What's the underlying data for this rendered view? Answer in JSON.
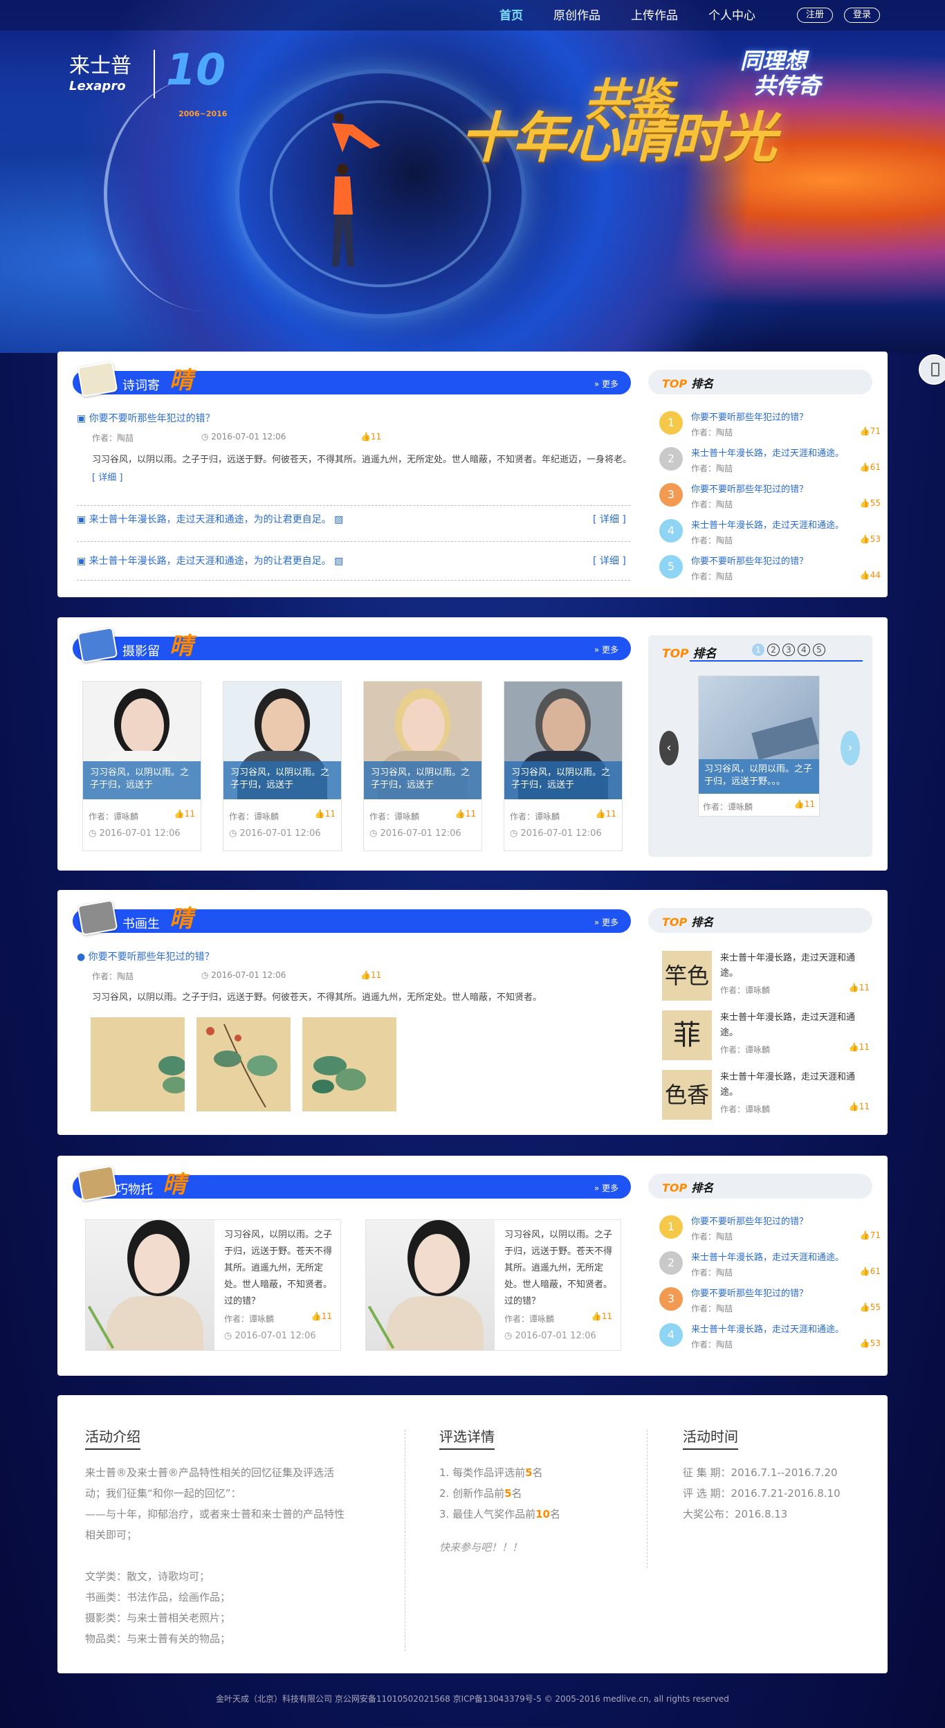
{
  "nav": {
    "items": [
      "首页",
      "原创作品",
      "上传作品",
      "个人中心"
    ],
    "register": "注册",
    "login": "登录"
  },
  "hero": {
    "brand_cn": "来士普",
    "brand_en": "Lexapro",
    "ten": "10",
    "years": "2006~2016",
    "slogan_right_1": "同理想",
    "slogan_right_2": "共传奇",
    "slogan_top": "共鉴",
    "slogan_main": "十年心晴时光"
  },
  "poem": {
    "title": "诗词寄",
    "hz": "晴",
    "more": "更多",
    "post_title": "你要不要听那些年犯过的错？",
    "post_author": "作者：陶喆",
    "post_date": "2016-07-01 12:06",
    "post_likes": "11",
    "post_body": "习习谷风，以阴以雨。之子于归，远送于野。何彼苍天，不得其所。逍遥九州，无所定处。世人暗蔽，不知贤者。年纪逝迈，一身将老。",
    "detail": "[ 详细 ]",
    "line_1": "来士普十年漫长路，走过天涯和通途，为的让君更自足。",
    "line_2": "来士普十年漫长路，走过天涯和通途，为的让君更自足。"
  },
  "rank_title": "排名",
  "rank_top": "TOP",
  "poem_rank": [
    {
      "num": "1",
      "title": "你要不要听那些年犯过的错？",
      "author": "作者：陶喆",
      "likes": "71",
      "color": "#f6c84a"
    },
    {
      "num": "2",
      "title": "来士普十年漫长路，走过天涯和通途。",
      "author": "作者：陶喆",
      "likes": "61",
      "color": "#c9c9c9"
    },
    {
      "num": "3",
      "title": "你要不要听那些年犯过的错？",
      "author": "作者：陶喆",
      "likes": "55",
      "color": "#f39a52"
    },
    {
      "num": "4",
      "title": "来士普十年漫长路，走过天涯和通途。",
      "author": "作者：陶喆",
      "likes": "53",
      "color": "#8ed4f5"
    },
    {
      "num": "5",
      "title": "你要不要听那些年犯过的错？",
      "author": "作者：陶喆",
      "likes": "44",
      "color": "#8ed4f5"
    }
  ],
  "photo": {
    "title": "摄影留",
    "hz": "晴",
    "more": "更多",
    "items": [
      {
        "cap": "习习谷风，以阴以雨。之子于归，远送于",
        "author": "作者：谭咏麟",
        "likes": "11",
        "date": "2016-07-01 12:06"
      },
      {
        "cap": "习习谷风，以阴以雨。之子于归，远送于",
        "author": "作者：谭咏麟",
        "likes": "11",
        "date": "2016-07-01 12:06"
      },
      {
        "cap": "习习谷风，以阴以雨。之子于归，远送于",
        "author": "作者：谭咏麟",
        "likes": "11",
        "date": "2016-07-01 12:06"
      },
      {
        "cap": "习习谷风，以阴以雨。之子于归，远送于",
        "author": "作者：谭咏麟",
        "likes": "11",
        "date": "2016-07-01 12:06"
      }
    ],
    "rank_pages": [
      "1",
      "2",
      "3",
      "4",
      "5"
    ],
    "slide_cap": "习习谷风，以阴以雨。之子于归，远送于野。。。",
    "slide_author": "作者：谭咏麟",
    "slide_likes": "11"
  },
  "paint": {
    "title": "书画生",
    "hz": "晴",
    "more": "更多",
    "post_title": "你要不要听那些年犯过的错？",
    "post_author": "作者：陶喆",
    "post_date": "2016-07-01 12:06",
    "post_likes": "11",
    "post_body": "习习谷风，以阴以雨。之子于归，远送于野。何彼苍天，不得其所。逍遥九州，无所定处。世人暗蔽，不知贤者。",
    "rank": [
      {
        "glyph": "竿色",
        "title": "来士普十年漫长路，走过天涯和通途。",
        "author": "作者：谭咏麟",
        "likes": "11"
      },
      {
        "glyph": "菲",
        "title": "来士普十年漫长路，走过天涯和通途。",
        "author": "作者：谭咏麟",
        "likes": "11"
      },
      {
        "glyph": "色香",
        "title": "来士普十年漫长路，走过天涯和通途。",
        "author": "作者：谭咏麟",
        "likes": "11"
      }
    ]
  },
  "craft": {
    "title": "巧物托",
    "hz": "晴",
    "more": "更多",
    "items": [
      {
        "text": "习习谷风，以阴以雨。之子于归，远送于野。苍天不得其所。逍遥九州，无所定处。世人暗蔽，不知贤者。过的错？",
        "author": "作者：谭咏麟",
        "likes": "11",
        "date": "2016-07-01 12:06"
      },
      {
        "text": "习习谷风，以阴以雨。之子于归，远送于野。苍天不得其所。逍遥九州，无所定处。世人暗蔽，不知贤者。过的错？",
        "author": "作者：谭咏麟",
        "likes": "11",
        "date": "2016-07-01 12:06"
      }
    ],
    "rank": [
      {
        "num": "1",
        "title": "你要不要听那些年犯过的错？",
        "author": "作者：陶喆",
        "likes": "71",
        "color": "#f6c84a"
      },
      {
        "num": "2",
        "title": "来士普十年漫长路，走过天涯和通途。",
        "author": "作者：陶喆",
        "likes": "61",
        "color": "#c9c9c9"
      },
      {
        "num": "3",
        "title": "你要不要听那些年犯过的错？",
        "author": "作者：陶喆",
        "likes": "55",
        "color": "#f39a52"
      },
      {
        "num": "4",
        "title": "来士普十年漫长路，走过天涯和通途。",
        "author": "作者：陶喆",
        "likes": "53",
        "color": "#8ed4f5"
      }
    ]
  },
  "footer": {
    "intro_title": "活动介绍",
    "intro_lines": [
      "来士普®及来士普®产品特性相关的回忆征集及评选活",
      "动；我们征集“和你一起的回忆”：",
      "——与十年，抑郁治疗，或者来士普和来士普的产品特性",
      "相关即可；",
      "",
      "文学类：散文，诗歌均可；",
      "书画类：书法作品，绘画作品；",
      "摄影类：与来士普相关老照片；",
      "物品类：与来士普有关的物品；"
    ],
    "select_title": "评选详情",
    "select_lines": [
      {
        "pre": "1. 每类作品评选前",
        "num": "5",
        "post": "名"
      },
      {
        "pre": "2. 创新作品前",
        "num": "5",
        "post": "名"
      },
      {
        "pre": "3. 最佳人气奖作品前",
        "num": "10",
        "post": "名"
      }
    ],
    "join": "快来参与吧！！！",
    "time_title": "活动时间",
    "time_lines": [
      "征 集 期：2016.7.1--2016.7.20",
      "评 选 期：2016.7.21-2016.8.10",
      "大奖公布：2016.8.13"
    ]
  },
  "copyright": "金叶天成（北京）科技有限公司 京公网安备11010502021568 京ICP备13043379号-5 © 2005-2016 medlive.cn, all rights reserved"
}
